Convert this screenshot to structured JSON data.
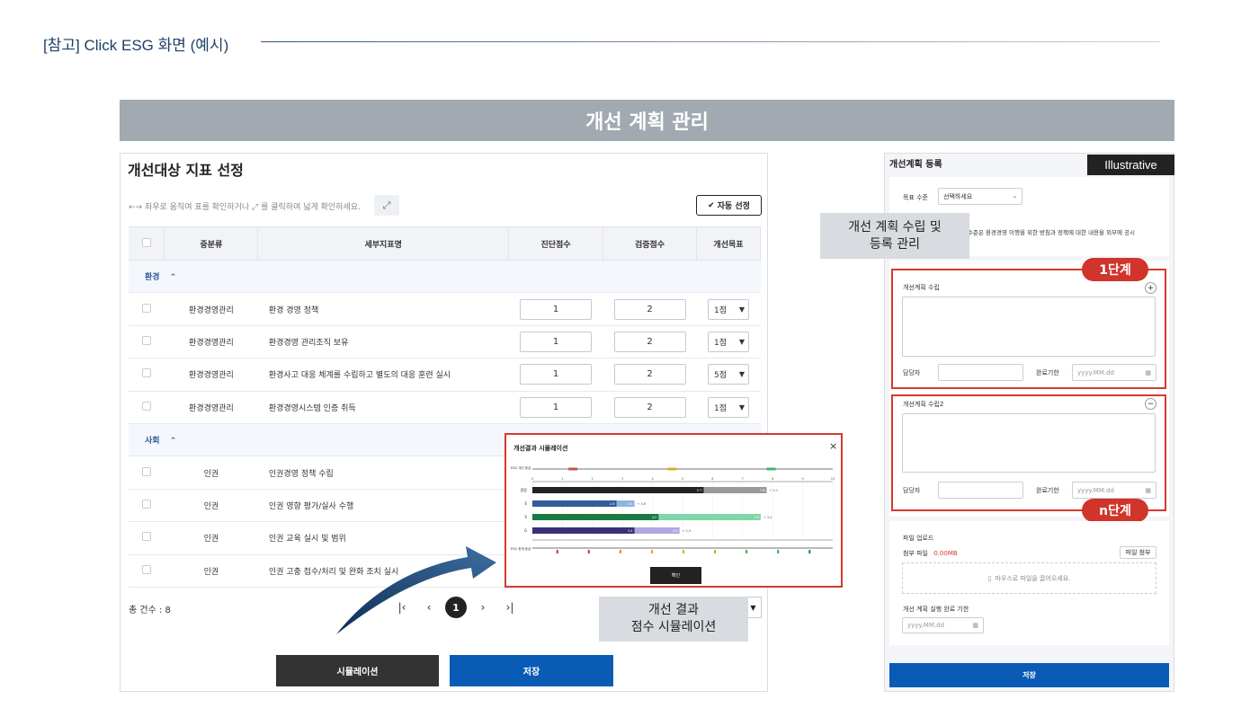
{
  "caption": "[참고] Click ESG 화면 (예시)",
  "banner_title": "개선 계획 관리",
  "left": {
    "title": "개선대상 지표 선정",
    "hint": "←→ 좌우로 움직여 표를 확인하거나 ⤢ 를 클릭하여 넓게 확인하세요.",
    "expand_icon": "⤢",
    "auto_select": "자동 선정",
    "check_icon": "✔",
    "columns": [
      "중분류",
      "세부지표명",
      "진단점수",
      "검증점수",
      "개선목표"
    ],
    "group_env": "환경",
    "group_soc": "사회",
    "chevron_up": "^",
    "env_rows": [
      {
        "category": "환경경영관리",
        "name": "환경 경영 정책",
        "diag": "1",
        "verify": "2",
        "goal": "1점"
      },
      {
        "category": "환경경영관리",
        "name": "환경경영 관리조직 보유",
        "diag": "1",
        "verify": "2",
        "goal": "1점"
      },
      {
        "category": "환경경영관리",
        "name": "환경사고 대응 체계를 수립하고 별도의 대응 훈련 실시",
        "diag": "1",
        "verify": "2",
        "goal": "5점"
      },
      {
        "category": "환경경영관리",
        "name": "환경경영시스템 인증 취득",
        "diag": "1",
        "verify": "2",
        "goal": "1점"
      }
    ],
    "soc_rows": [
      {
        "category": "인권",
        "name": "인권경영 정책 수립"
      },
      {
        "category": "인권",
        "name": "인권 영향 평가/실사 수행"
      },
      {
        "category": "인권",
        "name": "인권 교육 실시 및 범위"
      },
      {
        "category": "인권",
        "name": "인권 고충 접수/처리 및 완화 조치 실시"
      }
    ],
    "total": "총 건수 : 8",
    "pager": {
      "first": "|‹",
      "prev": "‹",
      "page": "1",
      "next": "›",
      "last": "›|"
    },
    "simulate_btn": "시뮬레이션",
    "save_btn": "저장"
  },
  "label_sim": {
    "line1": "개선 결과",
    "line2": "점수 시뮬레이션"
  },
  "label_reg": {
    "line1": "개선 계획 수립 및",
    "line2": "등록 관리"
  },
  "popup": {
    "title": "개선결과 시뮬레이션",
    "close": "×",
    "confirm": "확인",
    "esg_label_top": "ESG 개선 등급",
    "esg_label_bottom": "ESG 현재 등급",
    "deltas": [
      "+ 2.1",
      "+ 0.6",
      "+ 3.4",
      "+ 1.5"
    ]
  },
  "chart_data": {
    "type": "bar",
    "categories": [
      "종합",
      "E",
      "S",
      "G"
    ],
    "series": [
      {
        "values": [
          5.7,
          2.8,
          4.2,
          3.4
        ]
      },
      {
        "values": [
          7.8,
          3.4,
          7.6,
          4.9
        ]
      }
    ],
    "xlim": [
      0,
      10
    ],
    "colors": {
      "current": [
        "#222222",
        "#2f5c9a",
        "#1a7a43",
        "#3b2f7a"
      ],
      "improved": [
        "#9a9a9a",
        "#8fb3dd",
        "#7fd6a8",
        "#b3a6e0"
      ]
    }
  },
  "right": {
    "title": "개선계획 등록",
    "illustrative": "Illustrative",
    "goal_label": "목표 수준",
    "goal_select": "선택하세요",
    "desc": "수준은 환경경영 이행을 위한 방침과 정책에 대한 내용을 외부에 공시",
    "step1": "1단계",
    "stepn": "n단계",
    "plan1_label": "개선계획 수립",
    "plan2_label": "개선계획 수립2",
    "plus": "+",
    "minus": "−",
    "owner": "담당자",
    "deadline": "완료기한",
    "date_ph": "yyyy.MM.dd",
    "cal_icon": "▦",
    "upload_title": "파일 업로드",
    "attach_label": "첨부 파일",
    "attach_size": "0.00MB",
    "attach_btn": "파일 첨부",
    "drop_text": "마우스로 파일을 끌어오세요.",
    "done_label": "개선 계획 실행 완료 기한",
    "save": "저장"
  }
}
